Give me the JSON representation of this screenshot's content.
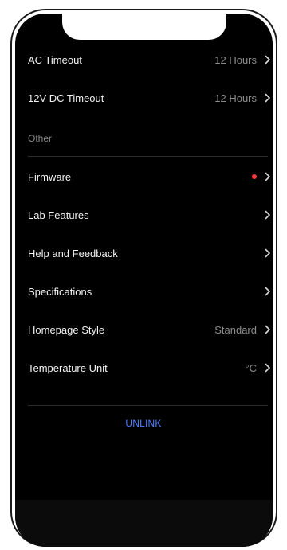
{
  "settings": {
    "ac_timeout": {
      "label": "AC Timeout",
      "value": "12 Hours"
    },
    "dc_timeout": {
      "label": "12V DC Timeout",
      "value": "12 Hours"
    },
    "section_other": "Other",
    "firmware": {
      "label": "Firmware"
    },
    "lab_features": {
      "label": "Lab Features"
    },
    "help_feedback": {
      "label": "Help and Feedback"
    },
    "specifications": {
      "label": "Specifications"
    },
    "homepage_style": {
      "label": "Homepage Style",
      "value": "Standard"
    },
    "temperature_unit": {
      "label": "Temperature Unit",
      "value": "°C"
    },
    "unlink_label": "UNLINK"
  },
  "icons": {
    "chevron": "chevron-right-icon",
    "badge": "red-dot-icon"
  },
  "colors": {
    "background": "#000000",
    "accent": "#4e7dff",
    "badge": "#ff3b3b"
  }
}
